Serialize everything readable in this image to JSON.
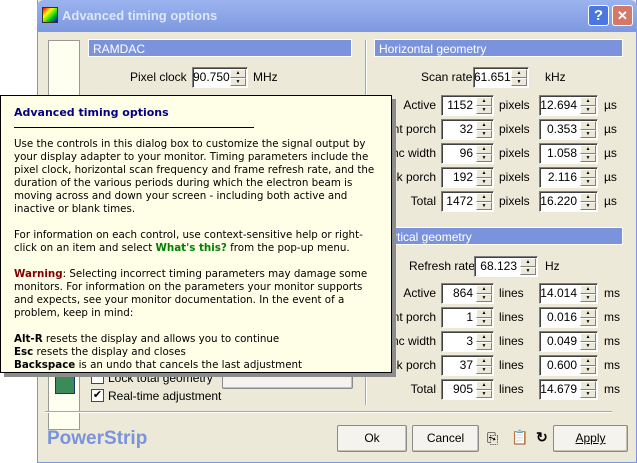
{
  "window": {
    "title": "Advanced timing options",
    "help": "?",
    "close": "✕"
  },
  "ramdac": {
    "header": "RAMDAC",
    "pixel_clock_label": "Pixel clock",
    "pixel_clock": "90.750",
    "unit": "MHz"
  },
  "horizontal": {
    "header": "Horizontal geometry",
    "scan_rate_label": "Scan rate",
    "scan_rate": "61.651",
    "scan_unit": "kHz",
    "rows": [
      {
        "label": "Active",
        "count": "1152",
        "unit": "pixels",
        "time": "12.694",
        "time_unit": "µs"
      },
      {
        "label": "Front porch",
        "count": "32",
        "unit": "pixels",
        "time": "0.353",
        "time_unit": "µs"
      },
      {
        "label": "Sync width",
        "count": "96",
        "unit": "pixels",
        "time": "1.058",
        "time_unit": "µs"
      },
      {
        "label": "Back porch",
        "count": "192",
        "unit": "pixels",
        "time": "2.116",
        "time_unit": "µs"
      },
      {
        "label": "Total",
        "count": "1472",
        "unit": "pixels",
        "time": "16.220",
        "time_unit": "µs"
      }
    ]
  },
  "vertical": {
    "header": "Vertical geometry",
    "refresh_label": "Refresh rate",
    "refresh": "68.123",
    "refresh_unit": "Hz",
    "rows": [
      {
        "label": "Active",
        "count": "864",
        "unit": "lines",
        "time": "14.014",
        "time_unit": "ms"
      },
      {
        "label": "Front porch",
        "count": "1",
        "unit": "lines",
        "time": "0.016",
        "time_unit": "ms"
      },
      {
        "label": "Sync width",
        "count": "3",
        "unit": "lines",
        "time": "0.049",
        "time_unit": "ms"
      },
      {
        "label": "Back porch",
        "count": "37",
        "unit": "lines",
        "time": "0.600",
        "time_unit": "ms"
      },
      {
        "label": "Total",
        "count": "905",
        "unit": "lines",
        "time": "14.679",
        "time_unit": "ms"
      }
    ]
  },
  "options": {
    "lock_total": "Lock total geometry",
    "realtime": "Real-time adjustment"
  },
  "footer": {
    "brand": "PowerStrip",
    "ok": "Ok",
    "cancel": "Cancel",
    "apply": "Apply"
  },
  "tooltip": {
    "title": "Advanced timing options",
    "p1": "Use the controls in this dialog box to customize the signal output by your display adapter to your monitor. Timing parameters include the pixel clock, horizontal scan frequency and frame refresh rate, and the duration of the various periods during which the electron beam is moving across and down your screen - including both active and inactive or blank times.",
    "p2a": "For information on each control, use context-sensitive help or right-click on an item and select ",
    "p2b": "What's this?",
    "p2c": " from the pop-up menu.",
    "warn": "Warning",
    "p3": ": Selecting incorrect timing parameters may damage some monitors. For information on the parameters your monitor supports and expects, see your monitor documentation. In the event of a problem, keep in mind:",
    "k1": "Alt-R",
    "k1t": " resets the display and allows you to continue",
    "k2": "Esc",
    "k2t": " resets the display and closes",
    "k3": "Backspace",
    "k3t": " is an undo that cancels the last adjustment"
  }
}
